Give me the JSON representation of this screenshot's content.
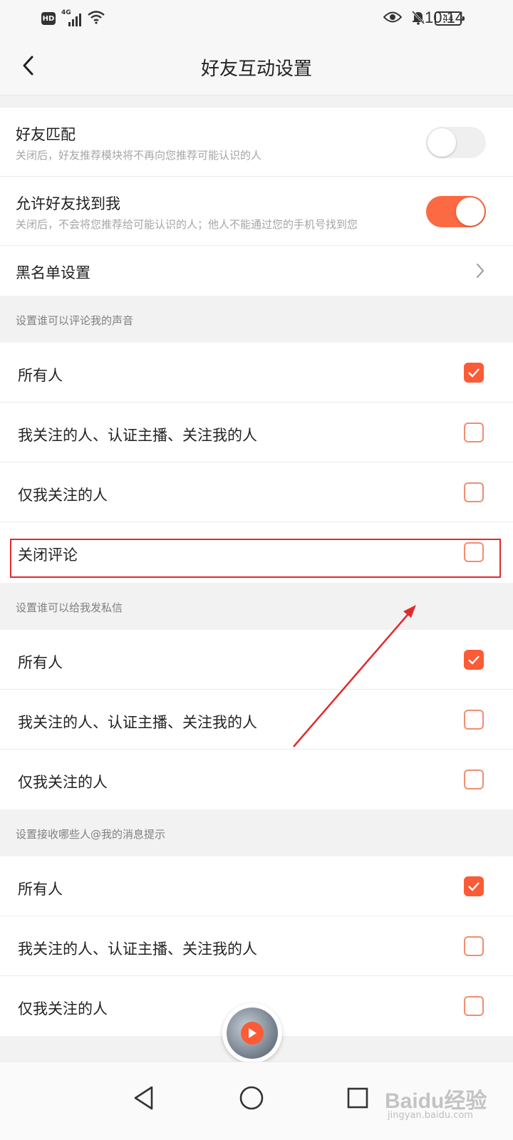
{
  "status_bar": {
    "hd": "HD",
    "network": "4G",
    "battery": "44",
    "time": "10:14"
  },
  "header": {
    "title": "好友互动设置"
  },
  "settings": {
    "friend_match": {
      "title": "好友匹配",
      "desc": "关闭后，好友推荐模块将不再向您推荐可能认识的人",
      "enabled": false
    },
    "allow_find": {
      "title": "允许好友找到我",
      "desc": "关闭后，不会将您推荐给可能认识的人；他人不能通过您的手机号找到您",
      "enabled": true
    },
    "blacklist": {
      "title": "黑名单设置"
    }
  },
  "comment_group": {
    "label": "设置谁可以评论我的声音",
    "options": [
      {
        "label": "所有人",
        "checked": true
      },
      {
        "label": "我关注的人、认证主播、关注我的人",
        "checked": false
      },
      {
        "label": "仅我关注的人",
        "checked": false
      },
      {
        "label": "关闭评论",
        "checked": false
      }
    ]
  },
  "message_group": {
    "label": "设置谁可以给我发私信",
    "options": [
      {
        "label": "所有人",
        "checked": true
      },
      {
        "label": "我关注的人、认证主播、关注我的人",
        "checked": false
      },
      {
        "label": "仅我关注的人",
        "checked": false
      }
    ]
  },
  "mention_group": {
    "label": "设置接收哪些人@我的消息提示",
    "options": [
      {
        "label": "所有人",
        "checked": true
      },
      {
        "label": "我关注的人、认证主播、关注我的人",
        "checked": false
      },
      {
        "label": "仅我关注的人",
        "checked": false
      }
    ]
  },
  "watermark": {
    "logo": "Baidu经验",
    "url": "jingyan.baidu.com"
  },
  "colors": {
    "accent": "#fb5b36",
    "annotation": "#e12b2b"
  }
}
